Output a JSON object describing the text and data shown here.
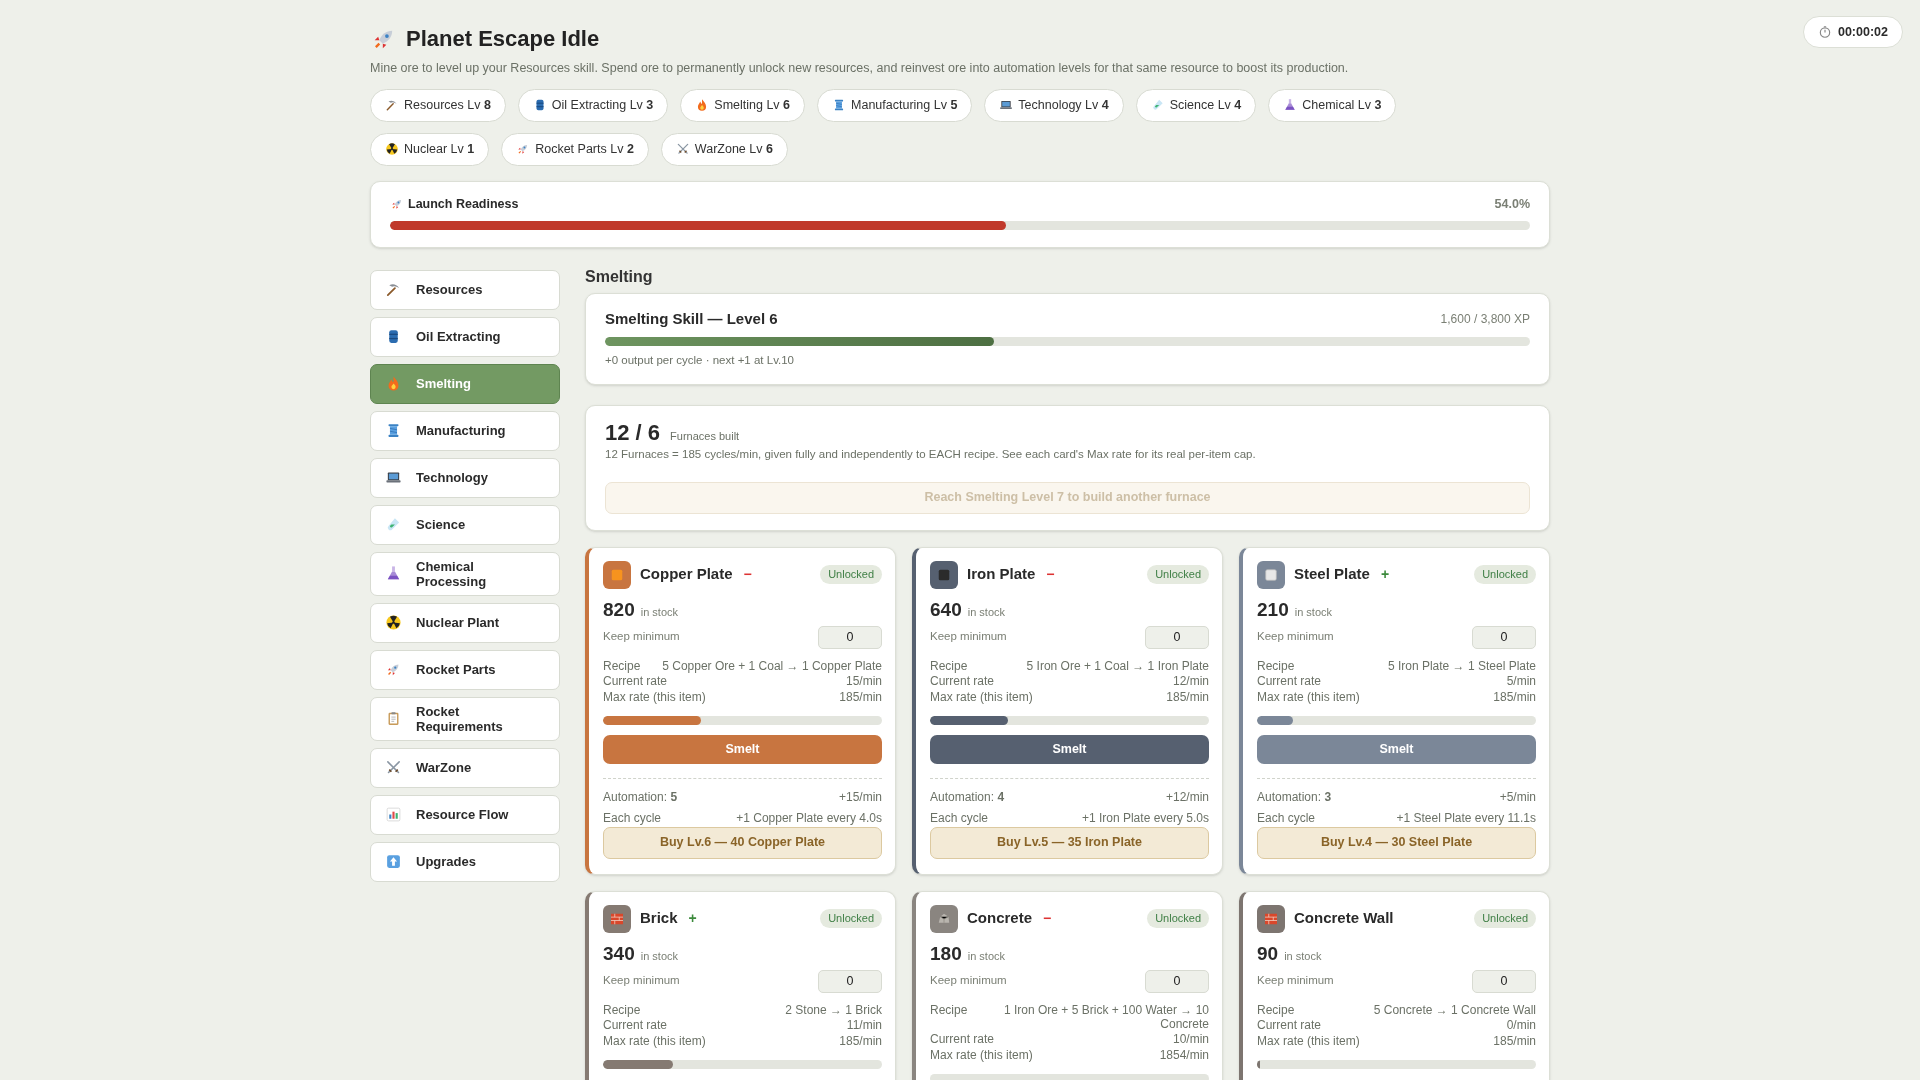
{
  "header": {
    "title": "Planet Escape Idle",
    "subtitle": "Mine ore to level up your Resources skill. Spend ore to permanently unlock new resources, and reinvest ore into automation levels for that same resource to boost its production.",
    "timer": "00:00:02"
  },
  "skills": [
    {
      "label": "Resources Lv **8**"
    },
    {
      "label": "Oil Extracting Lv **3**"
    },
    {
      "label": "Smelting Lv **6**"
    },
    {
      "label": "Manufacturing Lv **5**"
    },
    {
      "label": "Technology Lv **4**"
    },
    {
      "label": "Science Lv **4**"
    },
    {
      "label": "Chemical Lv **3**"
    },
    {
      "label": "Nuclear Lv **1**"
    },
    {
      "label": "Rocket Parts Lv **2**"
    },
    {
      "label": "WarZone Lv **6**"
    }
  ],
  "readiness": {
    "title": "Launch Readiness",
    "percent": "54.0%",
    "level": 0.54
  },
  "sidebar": {
    "items": [
      {
        "label": "Resources",
        "selected": false
      },
      {
        "label": "Oil Extracting",
        "selected": false
      },
      {
        "label": "Smelting",
        "selected": true
      },
      {
        "label": "Manufacturing",
        "selected": false
      },
      {
        "label": "Technology",
        "selected": false
      },
      {
        "label": "Science",
        "selected": false
      },
      {
        "label": "Chemical Processing",
        "selected": false
      },
      {
        "label": "Nuclear Plant",
        "selected": false
      },
      {
        "label": "Rocket Parts",
        "selected": false
      },
      {
        "label": "Rocket Requirements",
        "selected": false
      },
      {
        "label": "WarZone",
        "selected": false
      },
      {
        "label": "Resource Flow",
        "selected": false
      },
      {
        "label": "Upgrades",
        "selected": false
      }
    ]
  },
  "section_title": "Smelting",
  "skill": {
    "title": "Smelting Skill — Level 6",
    "xp": "1,600 / 3,800 XP",
    "level": 0.42,
    "note": "+0 output per cycle · next +1 at Lv.10"
  },
  "furnaces": {
    "count": "12 / 6",
    "label": "Furnaces built",
    "description": "12 Furnaces = 185 cycles/min, given fully and independently to EACH recipe. See each card's Max rate for its real per-item cap.",
    "button": "Reach Smelting Level 7 to build another furnace",
    "disabled": true
  },
  "recipes": [
    {
      "name": "Copper Plate",
      "color": "#c87540",
      "change": {
        "text": "−",
        "kind": "down"
      },
      "badge": "Unlocked",
      "stock": "820",
      "stock_label": "in stock",
      "keep_label": "Keep minimum",
      "keep_value": "0",
      "recipe_label": "Recipe",
      "recipe": "5 Copper Ore + 1 Coal → 1 Copper Plate",
      "rate_label": "Current rate",
      "rate": "15/min",
      "max_label": "Max rate (this item)",
      "max": "185/min",
      "level": 0.35,
      "action": "Smelt",
      "automation": "Automation: **5**",
      "automation_rate": "+15/min",
      "cycle_label": "Each cycle",
      "cycle": "+1 Copper Plate every 4.0s",
      "buy": "Buy Lv.6 — 40 Copper Plate"
    },
    {
      "name": "Iron Plate",
      "color": "#566070",
      "change": {
        "text": "−",
        "kind": "down"
      },
      "badge": "Unlocked",
      "stock": "640",
      "stock_label": "in stock",
      "keep_label": "Keep minimum",
      "keep_value": "0",
      "recipe_label": "Recipe",
      "recipe": "5 Iron Ore + 1 Coal → 1 Iron Plate",
      "rate_label": "Current rate",
      "rate": "12/min",
      "max_label": "Max rate (this item)",
      "max": "185/min",
      "level": 0.28,
      "action": "Smelt",
      "automation": "Automation: **4**",
      "automation_rate": "+12/min",
      "cycle_label": "Each cycle",
      "cycle": "+1 Iron Plate every 5.0s",
      "buy": "Buy Lv.5 — 35 Iron Plate"
    },
    {
      "name": "Steel Plate",
      "color": "#7b8798",
      "change": {
        "text": "+",
        "kind": "up"
      },
      "badge": "Unlocked",
      "stock": "210",
      "stock_label": "in stock",
      "keep_label": "Keep minimum",
      "keep_value": "0",
      "recipe_label": "Recipe",
      "recipe": "5 Iron Plate → 1 Steel Plate",
      "rate_label": "Current rate",
      "rate": "5/min",
      "max_label": "Max rate (this item)",
      "max": "185/min",
      "level": 0.13,
      "action": "Smelt",
      "automation": "Automation: **3**",
      "automation_rate": "+5/min",
      "cycle_label": "Each cycle",
      "cycle": "+1 Steel Plate every 11.1s",
      "buy": "Buy Lv.4 — 30 Steel Plate"
    },
    {
      "name": "Brick",
      "color": "#857a72",
      "change": {
        "text": "+",
        "kind": "up"
      },
      "badge": "Unlocked",
      "stock": "340",
      "stock_label": "in stock",
      "keep_label": "Keep minimum",
      "keep_value": "0",
      "recipe_label": "Recipe",
      "recipe": "2 Stone → 1 Brick",
      "rate_label": "Current rate",
      "rate": "11/min",
      "max_label": "Max rate (this item)",
      "max": "185/min",
      "level": 0.25
    },
    {
      "name": "Concrete",
      "color": "#8a8580",
      "change": {
        "text": "−",
        "kind": "down"
      },
      "badge": "Unlocked",
      "stock": "180",
      "stock_label": "in stock",
      "keep_label": "Keep minimum",
      "keep_value": "0",
      "recipe_label": "Recipe",
      "recipe": "1 Iron Ore + 5 Brick + 100 Water → 10 Concrete",
      "rate_label": "Current rate",
      "rate": "10/min",
      "max_label": "Max rate (this item)",
      "max": "1854/min",
      "level": 0
    },
    {
      "name": "Concrete Wall",
      "color": "#7d7570",
      "badge": "Unlocked",
      "stock": "90",
      "stock_label": "in stock",
      "keep_label": "Keep minimum",
      "keep_value": "0",
      "recipe_label": "Recipe",
      "recipe": "5 Concrete → 1 Concrete Wall",
      "rate_label": "Current rate",
      "rate": "0/min",
      "max_label": "Max rate (this item)",
      "max": "185/min",
      "level": 0.01
    }
  ]
}
